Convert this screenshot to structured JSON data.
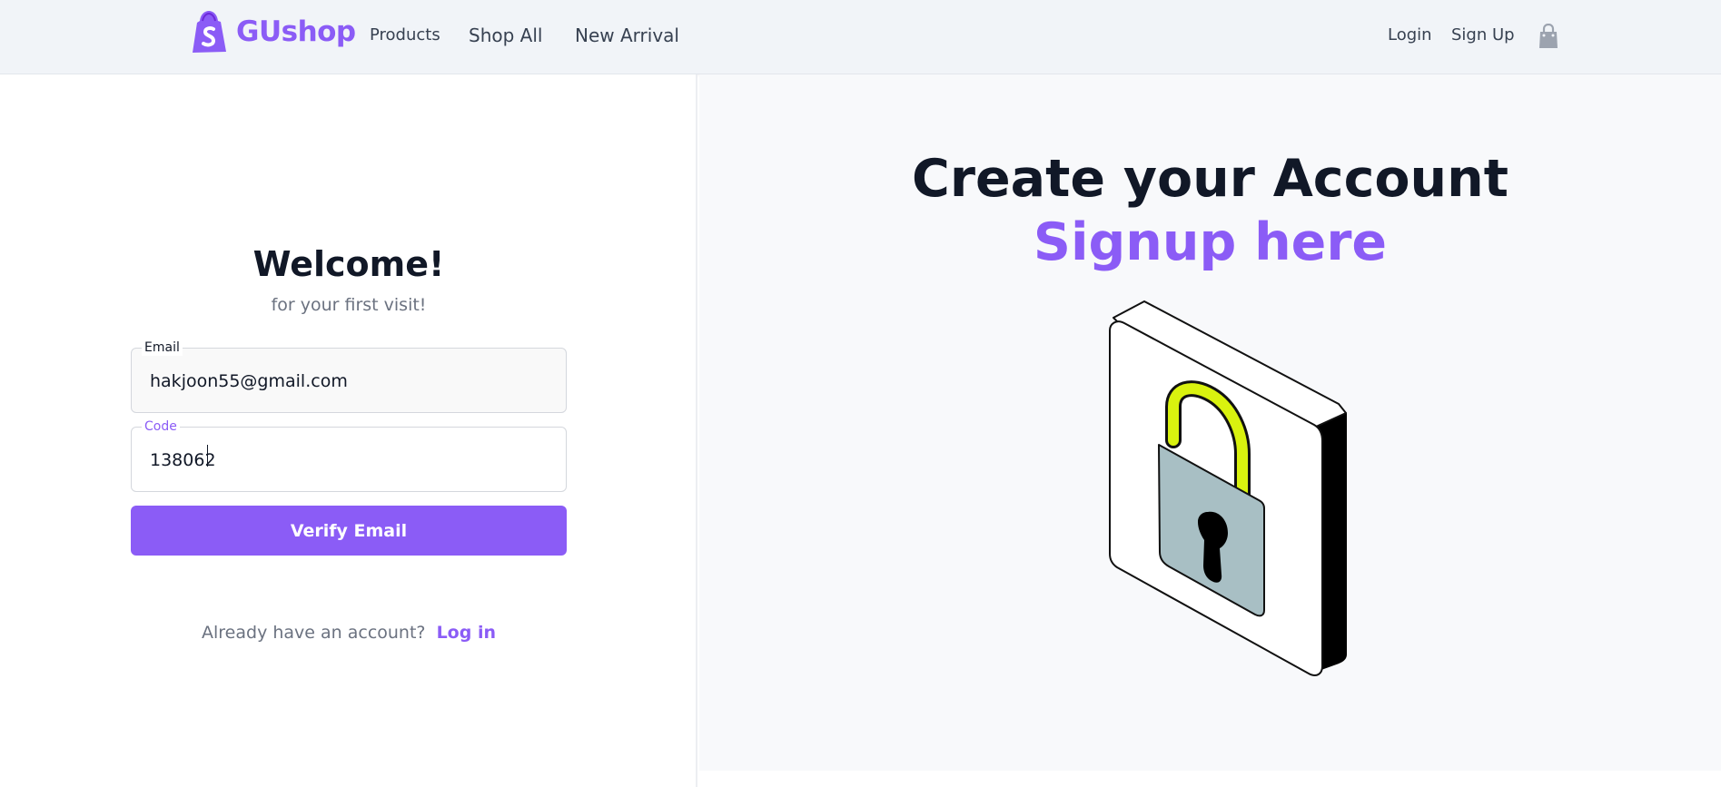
{
  "navbar": {
    "brand": "GUshop",
    "links": [
      "Products",
      "Shop All",
      "New Arrival"
    ],
    "login": "Login",
    "signup": "Sign Up",
    "icons": {
      "logo": "shopping-bag-logo-icon",
      "cart": "shopping-bag-icon"
    },
    "brand_color": "#8b5cf6"
  },
  "form": {
    "title": "Welcome!",
    "subtitle": "for your first visit!",
    "email_label": "Email",
    "email_value": "hakjoon55@gmail.com",
    "code_label": "Code",
    "code_value": "138062",
    "verify_button": "Verify Email",
    "already_text": "Already have an account?",
    "login_link": "Log in"
  },
  "hero": {
    "headline": "Create your Account",
    "headline_accent": "Signup here",
    "illustration": "unlocked-padlock-icon"
  }
}
